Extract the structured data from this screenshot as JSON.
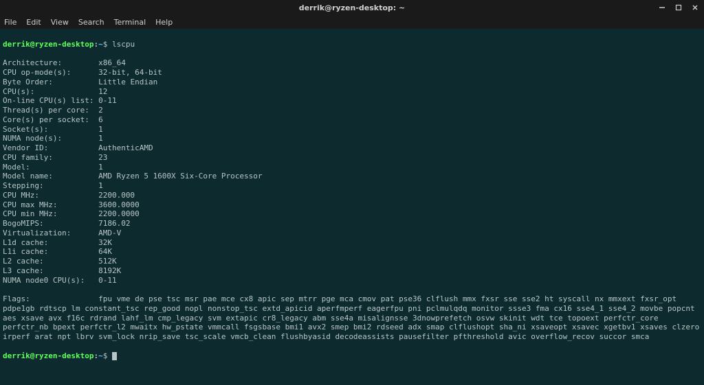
{
  "window": {
    "title": "derrik@ryzen-desktop: ~"
  },
  "menu": {
    "items": [
      "File",
      "Edit",
      "View",
      "Search",
      "Terminal",
      "Help"
    ]
  },
  "prompt": {
    "user": "derrik@ryzen-desktop",
    "sep": ":",
    "path": "~",
    "symbol": "$"
  },
  "command": "lscpu",
  "lscpu": [
    {
      "label": "Architecture:",
      "value": "x86_64"
    },
    {
      "label": "CPU op-mode(s):",
      "value": "32-bit, 64-bit"
    },
    {
      "label": "Byte Order:",
      "value": "Little Endian"
    },
    {
      "label": "CPU(s):",
      "value": "12"
    },
    {
      "label": "On-line CPU(s) list:",
      "value": "0-11"
    },
    {
      "label": "Thread(s) per core:",
      "value": "2"
    },
    {
      "label": "Core(s) per socket:",
      "value": "6"
    },
    {
      "label": "Socket(s):",
      "value": "1"
    },
    {
      "label": "NUMA node(s):",
      "value": "1"
    },
    {
      "label": "Vendor ID:",
      "value": "AuthenticAMD"
    },
    {
      "label": "CPU family:",
      "value": "23"
    },
    {
      "label": "Model:",
      "value": "1"
    },
    {
      "label": "Model name:",
      "value": "AMD Ryzen 5 1600X Six-Core Processor"
    },
    {
      "label": "Stepping:",
      "value": "1"
    },
    {
      "label": "CPU MHz:",
      "value": "2200.000"
    },
    {
      "label": "CPU max MHz:",
      "value": "3600.0000"
    },
    {
      "label": "CPU min MHz:",
      "value": "2200.0000"
    },
    {
      "label": "BogoMIPS:",
      "value": "7186.02"
    },
    {
      "label": "Virtualization:",
      "value": "AMD-V"
    },
    {
      "label": "L1d cache:",
      "value": "32K"
    },
    {
      "label": "L1i cache:",
      "value": "64K"
    },
    {
      "label": "L2 cache:",
      "value": "512K"
    },
    {
      "label": "L3 cache:",
      "value": "8192K"
    },
    {
      "label": "NUMA node0 CPU(s):",
      "value": "0-11"
    }
  ],
  "flags_label": "Flags:",
  "flags_value": "fpu vme de pse tsc msr pae mce cx8 apic sep mtrr pge mca cmov pat pse36 clflush mmx fxsr sse sse2 ht syscall nx mmxext fxsr_opt pdpe1gb rdtscp lm constant_tsc rep_good nopl nonstop_tsc extd_apicid aperfmperf eagerfpu pni pclmulqdq monitor ssse3 fma cx16 sse4_1 sse4_2 movbe popcnt aes xsave avx f16c rdrand lahf_lm cmp_legacy svm extapic cr8_legacy abm sse4a misalignsse 3dnowprefetch osvw skinit wdt tce topoext perfctr_core perfctr_nb bpext perfctr_l2 mwaitx hw_pstate vmmcall fsgsbase bmi1 avx2 smep bmi2 rdseed adx smap clflushopt sha_ni xsaveopt xsavec xgetbv1 xsaves clzero irperf arat npt lbrv svm_lock nrip_save tsc_scale vmcb_clean flushbyasid decodeassists pausefilter pfthreshold avic overflow_recov succor smca"
}
